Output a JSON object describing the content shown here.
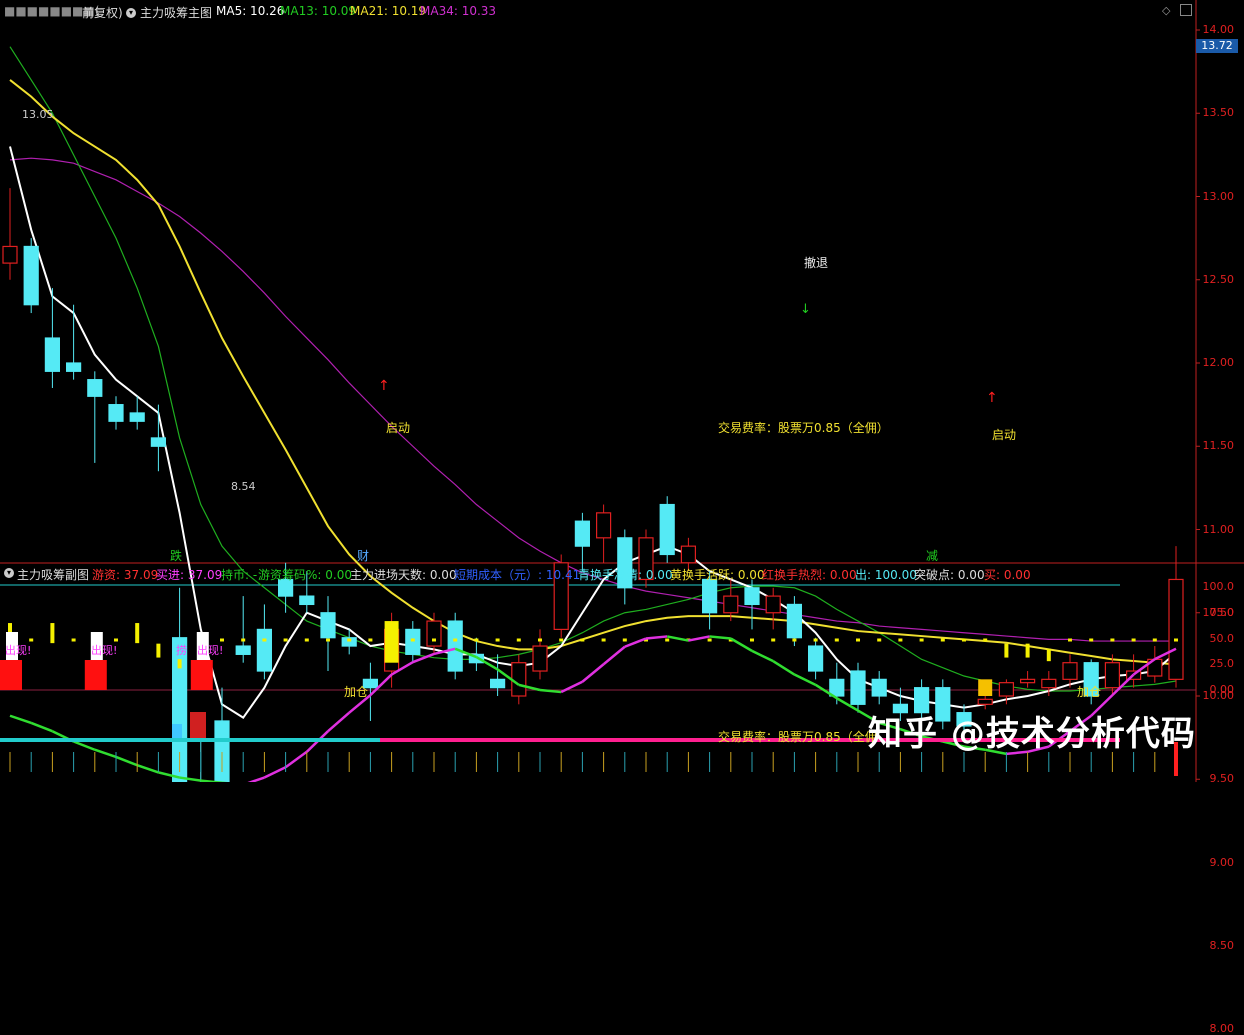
{
  "colors": {
    "bg": "#000000",
    "up": "#e02020",
    "down": "#55eaf5",
    "ma5": "#ffffff",
    "ma13": "#1fae1f",
    "ma21": "#f0e030",
    "ma34": "#b020b0",
    "axis": "#c02020"
  },
  "main": {
    "prefix": "前复权)",
    "indicator": "主力吸筹主图",
    "ma5": "MA5: 10.26",
    "ma13": "MA13: 10.09",
    "ma21": "MA21: 10.19",
    "ma34": "MA34: 10.33",
    "price_badge": "13.72",
    "high_label": "13.05",
    "low_label": "8.54",
    "annotations": {
      "start1": "启动",
      "start2": "启动",
      "retreat": "撤退",
      "fee1": "交易费率：股票万0.85（全佣）",
      "fee2": "交易费率：股票万0.85（全佣",
      "die": "跌",
      "cai": "财",
      "jian": "减",
      "add1": "加仓",
      "add2": "加仓",
      "appear1": "出现!",
      "appear2": "出现!",
      "appear3": "出现!",
      "lao": "捞"
    },
    "yticks": [
      "14.00",
      "13.50",
      "13.00",
      "12.50",
      "12.00",
      "11.50",
      "11.00",
      "10.50",
      "10.00",
      "9.50",
      "9.00",
      "8.50",
      "8.00"
    ]
  },
  "sub": {
    "title": "主力吸筹副图",
    "youzi": "游资: 37.09",
    "mai": "买进: 37.09",
    "chibi": "持币: -",
    "youzi_pct": "游资筹码%: 0.00",
    "zhuli_days": "主力进场天数: 0.00",
    "chengben": "短期成本（元）: 10.41",
    "qing": "青换手冷清: 0.00",
    "huang": "黄换手活跃: 0.00",
    "hong": "红换手热烈: 0.00",
    "chu": "出: 100.00",
    "tupo": "突破点: 0.00",
    "mai2": "买: 0.00",
    "yticks": [
      "100.0",
      "75.0",
      "50.0",
      "25.0",
      "0.00"
    ]
  },
  "watermark": "知乎 @技术分析代码",
  "chart_data": [
    {
      "type": "candlestick",
      "candles": [
        {
          "o": 12.6,
          "c": 12.7,
          "h": 13.05,
          "l": 12.5
        },
        {
          "o": 12.7,
          "c": 12.35,
          "h": 12.75,
          "l": 12.3
        },
        {
          "o": 12.15,
          "c": 11.95,
          "h": 12.45,
          "l": 11.85
        },
        {
          "o": 12.0,
          "c": 11.95,
          "h": 12.35,
          "l": 11.9
        },
        {
          "o": 11.9,
          "c": 11.8,
          "h": 11.95,
          "l": 11.4
        },
        {
          "o": 11.75,
          "c": 11.65,
          "h": 11.8,
          "l": 11.6
        },
        {
          "o": 11.7,
          "c": 11.65,
          "h": 11.8,
          "l": 11.6
        },
        {
          "o": 11.55,
          "c": 11.5,
          "h": 11.75,
          "l": 11.35
        },
        {
          "o": 10.35,
          "c": 9.2,
          "h": 10.65,
          "l": 9.2
        },
        {
          "o": 9.45,
          "c": 9.3,
          "h": 9.85,
          "l": 9.2
        },
        {
          "o": 9.85,
          "c": 9.35,
          "h": 10.05,
          "l": 8.54
        },
        {
          "o": 10.3,
          "c": 10.25,
          "h": 10.6,
          "l": 10.2
        },
        {
          "o": 10.4,
          "c": 10.15,
          "h": 10.55,
          "l": 10.1
        },
        {
          "o": 10.7,
          "c": 10.6,
          "h": 10.8,
          "l": 10.5
        },
        {
          "o": 10.6,
          "c": 10.55,
          "h": 10.75,
          "l": 10.5
        },
        {
          "o": 10.5,
          "c": 10.35,
          "h": 10.6,
          "l": 10.15
        },
        {
          "o": 10.35,
          "c": 10.3,
          "h": 10.4,
          "l": 10.25
        },
        {
          "o": 10.1,
          "c": 10.05,
          "h": 10.2,
          "l": 9.85
        },
        {
          "o": 10.15,
          "c": 10.4,
          "h": 10.5,
          "l": 10.05
        },
        {
          "o": 10.4,
          "c": 10.25,
          "h": 10.45,
          "l": 10.2
        },
        {
          "o": 10.3,
          "c": 10.45,
          "h": 10.5,
          "l": 10.25
        },
        {
          "o": 10.45,
          "c": 10.15,
          "h": 10.5,
          "l": 10.1
        },
        {
          "o": 10.25,
          "c": 10.2,
          "h": 10.35,
          "l": 10.15
        },
        {
          "o": 10.1,
          "c": 10.05,
          "h": 10.25,
          "l": 10.0
        },
        {
          "o": 10.0,
          "c": 10.2,
          "h": 10.25,
          "l": 9.95
        },
        {
          "o": 10.15,
          "c": 10.3,
          "h": 10.4,
          "l": 10.1
        },
        {
          "o": 10.4,
          "c": 10.8,
          "h": 10.85,
          "l": 10.35
        },
        {
          "o": 11.05,
          "c": 10.9,
          "h": 11.1,
          "l": 10.75
        },
        {
          "o": 10.95,
          "c": 11.1,
          "h": 11.15,
          "l": 10.8
        },
        {
          "o": 10.95,
          "c": 10.65,
          "h": 11.0,
          "l": 10.55
        },
        {
          "o": 10.7,
          "c": 10.95,
          "h": 11.0,
          "l": 10.65
        },
        {
          "o": 11.15,
          "c": 10.85,
          "h": 11.2,
          "l": 10.8
        },
        {
          "o": 10.8,
          "c": 10.9,
          "h": 10.95,
          "l": 10.75
        },
        {
          "o": 10.7,
          "c": 10.5,
          "h": 10.75,
          "l": 10.4
        },
        {
          "o": 10.5,
          "c": 10.6,
          "h": 10.7,
          "l": 10.45
        },
        {
          "o": 10.65,
          "c": 10.55,
          "h": 10.7,
          "l": 10.4
        },
        {
          "o": 10.5,
          "c": 10.6,
          "h": 10.65,
          "l": 10.4
        },
        {
          "o": 10.55,
          "c": 10.35,
          "h": 10.6,
          "l": 10.3
        },
        {
          "o": 10.3,
          "c": 10.15,
          "h": 10.35,
          "l": 10.1
        },
        {
          "o": 10.1,
          "c": 10.0,
          "h": 10.2,
          "l": 9.95
        },
        {
          "o": 10.15,
          "c": 9.95,
          "h": 10.2,
          "l": 9.9
        },
        {
          "o": 10.1,
          "c": 10.0,
          "h": 10.15,
          "l": 9.95
        },
        {
          "o": 9.95,
          "c": 9.9,
          "h": 10.05,
          "l": 9.85
        },
        {
          "o": 10.05,
          "c": 9.9,
          "h": 10.1,
          "l": 9.85
        },
        {
          "o": 10.05,
          "c": 9.85,
          "h": 10.1,
          "l": 9.8
        },
        {
          "o": 9.9,
          "c": 9.82,
          "h": 9.95,
          "l": 9.78
        },
        {
          "o": 9.95,
          "c": 9.98,
          "h": 10.05,
          "l": 9.92
        },
        {
          "o": 10.0,
          "c": 10.08,
          "h": 10.1,
          "l": 9.95
        },
        {
          "o": 10.08,
          "c": 10.1,
          "h": 10.15,
          "l": 10.05
        },
        {
          "o": 10.05,
          "c": 10.1,
          "h": 10.15,
          "l": 10.0
        },
        {
          "o": 10.1,
          "c": 10.2,
          "h": 10.25,
          "l": 10.05
        },
        {
          "o": 10.2,
          "c": 10.0,
          "h": 10.22,
          "l": 9.95
        },
        {
          "o": 10.05,
          "c": 10.2,
          "h": 10.25,
          "l": 10.0
        },
        {
          "o": 10.1,
          "c": 10.15,
          "h": 10.25,
          "l": 10.05
        },
        {
          "o": 10.12,
          "c": 10.22,
          "h": 10.3,
          "l": 10.08
        },
        {
          "o": 10.1,
          "c": 10.7,
          "h": 10.9,
          "l": 10.05
        }
      ],
      "ma5": [
        13.3,
        12.8,
        12.4,
        12.3,
        12.05,
        11.9,
        11.8,
        11.7,
        11.1,
        10.4,
        9.95,
        9.87,
        10.05,
        10.3,
        10.5,
        10.45,
        10.4,
        10.3,
        10.32,
        10.3,
        10.28,
        10.25,
        10.25,
        10.2,
        10.18,
        10.2,
        10.3,
        10.5,
        10.7,
        10.8,
        10.85,
        10.9,
        10.85,
        10.75,
        10.7,
        10.65,
        10.58,
        10.5,
        10.38,
        10.22,
        10.1,
        10.05,
        10.0,
        9.97,
        9.95,
        9.93,
        9.95,
        9.98,
        10.0,
        10.03,
        10.07,
        10.1,
        10.12,
        10.13,
        10.15,
        10.26
      ],
      "ma13": [
        13.9,
        13.7,
        13.5,
        13.25,
        13.0,
        12.75,
        12.45,
        12.1,
        11.55,
        11.15,
        10.9,
        10.75,
        10.65,
        10.55,
        10.45,
        10.4,
        10.35,
        10.3,
        10.27,
        10.25,
        10.23,
        10.22,
        10.22,
        10.23,
        10.25,
        10.28,
        10.32,
        10.38,
        10.45,
        10.5,
        10.52,
        10.55,
        10.58,
        10.62,
        10.65,
        10.66,
        10.66,
        10.65,
        10.6,
        10.52,
        10.45,
        10.38,
        10.3,
        10.22,
        10.17,
        10.12,
        10.09,
        10.06,
        10.04,
        10.03,
        10.03,
        10.04,
        10.05,
        10.06,
        10.07,
        10.09
      ],
      "ma21": [
        13.7,
        13.6,
        13.48,
        13.38,
        13.3,
        13.22,
        13.1,
        12.95,
        12.7,
        12.42,
        12.15,
        11.92,
        11.7,
        11.48,
        11.25,
        11.02,
        10.85,
        10.72,
        10.62,
        10.53,
        10.45,
        10.38,
        10.33,
        10.3,
        10.28,
        10.28,
        10.3,
        10.34,
        10.38,
        10.42,
        10.45,
        10.47,
        10.48,
        10.48,
        10.48,
        10.47,
        10.46,
        10.45,
        10.43,
        10.41,
        10.39,
        10.38,
        10.37,
        10.36,
        10.35,
        10.34,
        10.33,
        10.32,
        10.3,
        10.28,
        10.26,
        10.24,
        10.22,
        10.21,
        10.2,
        10.19
      ],
      "ma34": [
        13.22,
        13.23,
        13.22,
        13.2,
        13.15,
        13.1,
        13.03,
        12.96,
        12.88,
        12.78,
        12.67,
        12.55,
        12.42,
        12.28,
        12.15,
        12.02,
        11.88,
        11.75,
        11.62,
        11.5,
        11.38,
        11.27,
        11.15,
        11.05,
        10.95,
        10.87,
        10.8,
        10.74,
        10.7,
        10.66,
        10.63,
        10.61,
        10.59,
        10.57,
        10.55,
        10.53,
        10.51,
        10.49,
        10.47,
        10.45,
        10.44,
        10.42,
        10.41,
        10.4,
        10.39,
        10.38,
        10.37,
        10.36,
        10.35,
        10.34,
        10.34,
        10.33,
        10.33,
        10.33,
        10.33,
        10.33
      ]
    },
    {
      "type": "line",
      "ylim": [
        0,
        100
      ],
      "line": [
        -25,
        -32,
        -40,
        -50,
        -58,
        -65,
        -73,
        -80,
        -85,
        -88,
        -90,
        -92,
        -85,
        -75,
        -60,
        -40,
        -22,
        -5,
        15,
        27,
        35,
        40,
        32,
        20,
        5,
        0,
        -2,
        8,
        25,
        42,
        50,
        52,
        48,
        52,
        50,
        38,
        28,
        15,
        5,
        -8,
        -20,
        -32,
        -38,
        -45,
        -50,
        -55,
        -58,
        -62,
        -60,
        -55,
        -40,
        -25,
        -5,
        15,
        30,
        40
      ],
      "yellow_bars": [
        65,
        12,
        65,
        12,
        12,
        12,
        65,
        45,
        30,
        20,
        12,
        6,
        5,
        5,
        5,
        5,
        5,
        5,
        5,
        5,
        5,
        5,
        5,
        5,
        5,
        5,
        5,
        5,
        5,
        5,
        5,
        5,
        5,
        5,
        5,
        5,
        5,
        5,
        5,
        5,
        5,
        5,
        5,
        5,
        5,
        5,
        5,
        45,
        45,
        40,
        12,
        8,
        5,
        5,
        5,
        5
      ]
    }
  ]
}
